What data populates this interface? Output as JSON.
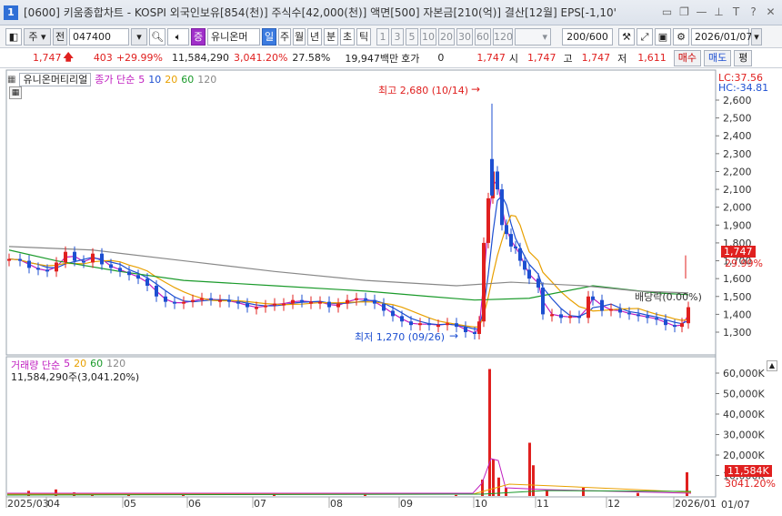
{
  "window": {
    "number": "1",
    "title": "[0600] 키움종합차트 - KOSPI 외국인보유[854(천)] 주식수[42,000(천)] 액면[500] 자본금[210(억)] 결산[12월] EPS[-1,10'"
  },
  "toolbar": {
    "market": "주",
    "whole": "전",
    "code": "047400",
    "name": "유니온머티",
    "name_tag": "증",
    "periods": [
      "일",
      "주",
      "월",
      "년",
      "분",
      "초",
      "틱"
    ],
    "active_period": "일",
    "intervals": [
      "1",
      "3",
      "5",
      "10",
      "20",
      "30",
      "60",
      "120"
    ],
    "count": "200",
    "count_max": "/600",
    "date": "2026/01/07"
  },
  "quote": {
    "price": "1,747",
    "change": "403",
    "change_rate": "+29.99%",
    "volume": "11,584,290",
    "volume_rate": "3,041.20%",
    "ratio": "27.58%",
    "trade_value": "19,947백만",
    "hoga_label": "호가",
    "hoga_value": "0",
    "hoga_price": "1,747",
    "open_label": "시",
    "open": "1,747",
    "high_label": "고",
    "high": "1,747",
    "low_label": "저",
    "low": "1,611",
    "buy_label": "매수",
    "sell_label": "매도",
    "eval_label": "평"
  },
  "price_panel": {
    "stock_name": "유니온머티리얼",
    "legend_prefix": "종가 단순",
    "ma_periods": [
      "5",
      "10",
      "20",
      "60",
      "120"
    ],
    "lc_label": "LC:37.56",
    "hc_label": "HC:-34.81",
    "high_annotation": "최고 2,680 (10/14)",
    "low_annotation": "최저 1,270 (09/26)",
    "dividend_label": "배당락(0.00%)",
    "current_price_tag": "1,747",
    "current_rate_tag": "29.99%",
    "yaxis": [
      "2,600",
      "2,500",
      "2,400",
      "2,300",
      "2,200",
      "2,100",
      "2,000",
      "1,900",
      "1,800",
      "1,700",
      "1,600",
      "1,500",
      "1,400",
      "1,300"
    ]
  },
  "volume_panel": {
    "legend_prefix": "거래량 단순",
    "ma_periods": [
      "5",
      "20",
      "60",
      "120"
    ],
    "value_label": "11,584,290주(3,041.20%)",
    "yaxis": [
      "60,000K",
      "50,000K",
      "40,000K",
      "30,000K",
      "20,000K",
      "10,000K"
    ],
    "current_tag": "11,584K",
    "rate_tag": "3041.20%"
  },
  "xaxis": {
    "labels": [
      "2025/03",
      "04",
      "05",
      "06",
      "07",
      "08",
      "09",
      "10",
      "11",
      "12",
      "2026/01"
    ],
    "right_label": "01/07"
  },
  "colors": {
    "up": "#e0201f",
    "down": "#1d4fd1",
    "ma5": "#c020c0",
    "ma10": "#1d4fd1",
    "ma20": "#e8a000",
    "ma60": "#1a9a2a",
    "ma120": "#888888"
  },
  "icons": [
    "restore-icon",
    "minimize-icon",
    "pin-icon",
    "font-icon",
    "help-icon",
    "close-icon",
    "search-icon",
    "speaker-icon",
    "settings-icon",
    "save-icon"
  ]
}
